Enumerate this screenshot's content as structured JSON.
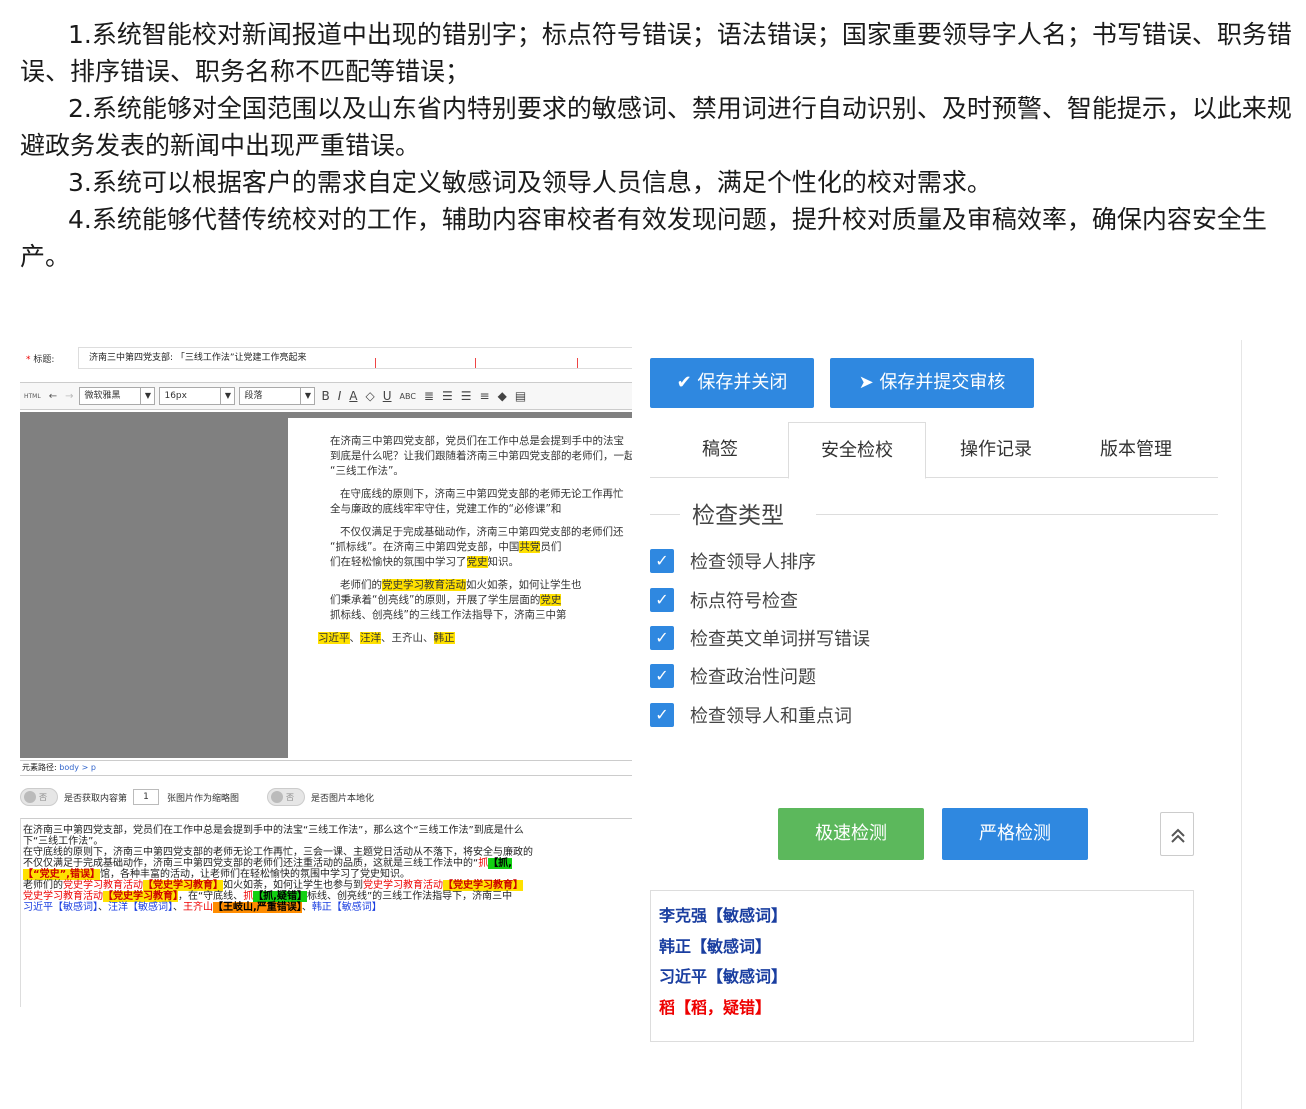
{
  "intro": [
    "1.系统智能校对新闻报道中出现的错别字；标点符号错误；语法错误；国家重要领导字人名；书写错误、职务错误、排序错误、职务名称不匹配等错误；",
    "2.系统能够对全国范围以及山东省内特别要求的敏感词、禁用词进行自动识别、及时预警、智能提示，以此来规避政务发表的新闻中出现严重错误。",
    "3.系统可以根据客户的需求自定义敏感词及领导人员信息，满足个性化的校对需求。",
    "4.系统能够代替传统校对的工作，辅助内容审校者有效发现问题，提升校对质量及审稿效率，确保内容安全生产。"
  ],
  "editor": {
    "title_label": "标题:",
    "title_value": "济南三中第四党支部: 「三线工作法”让党建工作亮起来",
    "font_family": "微软雅黑",
    "font_size": "16px",
    "paragraph": "段落",
    "html_label": "HTML",
    "doc": {
      "p1_l1": "在济南三中第四党支部，党员们在工作中总是会提到手中的法宝",
      "p1_l2": "到底是什么呢？让我们跟随着济南三中第四党支部的老师们，一起来",
      "p1_l3": "“三线工作法”。",
      "p2_l1": "在守底线的原则下，济南三中第四党支部的老师无论工作再忙",
      "p2_l2": "全与廉政的底线牢牢守住，党建工作的“必修课”和",
      "p3_l1": "不仅仅满足于完成基础动作，济南三中第四党支部的老师们还",
      "p3_l2a": "“抓标线”。在济南三中第四党支部，中国",
      "p3_l2_hl": "共党",
      "p3_l2b": "员们",
      "p3_l3a": "们在轻松愉快的氛围中学习了",
      "p3_l3_hl": "党史",
      "p3_l3b": "知识。",
      "p4_l1a": "老师们的",
      "p4_l1_hl": "党史学习教育活动",
      "p4_l1b": "如火如荼，如何让学生也",
      "p4_l2a": "们秉承着“创亮线”的原则，开展了学生层面的",
      "p4_l2_hl": "党史",
      "p4_l3": "抓标线、创亮线”的三线工作法指导下，济南三中第",
      "names_1": "习近平",
      "names_sep1": "、",
      "names_2": "汪洋",
      "names_sep2": "、王齐山、",
      "names_3": "韩正"
    },
    "path_label": "元素路径:",
    "path_value": "body > p",
    "toggle_off": "否",
    "opt1_label": "是否获取内容第",
    "opt1_num": "1",
    "opt1_suffix": "张图片作为缩略图",
    "opt2_label": "是否图片本地化",
    "plain": {
      "l1": "在济南三中第四党支部，党员们在工作中总是会提到手中的法宝“三线工作法”，那么这个“三线工作法”到底是什么",
      "l2": "下“三线工作法”。",
      "l3": "在守底线的原则下，济南三中第四党支部的老师无论工作再忙，三会一课、主题党日活动从不落下，将安全与廉政的",
      "l4a": "不仅仅满足于完成基础动作，济南三中第四党支部的老师们还注重活动的品质，这就是三线工作法中的“",
      "l4_r": "抓",
      "l4_tag": "【抓,",
      "l5_tag": "【“党史”,错误】",
      "l5b": "馆，各种丰富的活动，让老师们在轻松愉快的氛围中学习了党史知识。",
      "l6a": "老师们的",
      "l6_r": "党史学习教育活动",
      "l6_tag": "【党史学习教育】",
      "l6b": "如火如荼，如何让学生也参与到",
      "l6_r2": "党史学习教育活动",
      "l6_tag2": "【党史学习教育】",
      "l7_r": "党史学习教育活动",
      "l7_tag": "【党史学习教育】",
      "l7b": "，在“守底线、",
      "l7_r2": "抓",
      "l7_tag2": "【抓,疑错】",
      "l7c": "标线、创亮线”的三线工作法指导下，济南三中",
      "l8_1": "习近平【敏感词】",
      "l8_s1": "、",
      "l8_2": "汪洋【敏感词】",
      "l8_s2": "、",
      "l8_3r": "王齐山",
      "l8_3tag": "【王岐山,严重错误】",
      "l8_s3": "、",
      "l8_4": "韩正【敏感词】"
    }
  },
  "panel": {
    "save_close": "保存并关闭",
    "save_submit": "保存并提交审核",
    "tabs": [
      "稿签",
      "安全检校",
      "操作记录",
      "版本管理"
    ],
    "section_title": "检查类型",
    "checks": [
      "检查领导人排序",
      "标点符号检查",
      "检查英文单词拼写错误",
      "检查政治性问题",
      "检查领导人和重点词"
    ],
    "fast_check": "极速检测",
    "strict_check": "严格检测",
    "results": [
      "李克强【敏感词】",
      "韩正【敏感词】",
      "习近平【敏感词】",
      "稻【稻，疑错】"
    ],
    "colors": {
      "primary": "#2f88e0",
      "green": "#5cb85c",
      "error": "#e00000",
      "highlight": "#ffe100"
    }
  }
}
